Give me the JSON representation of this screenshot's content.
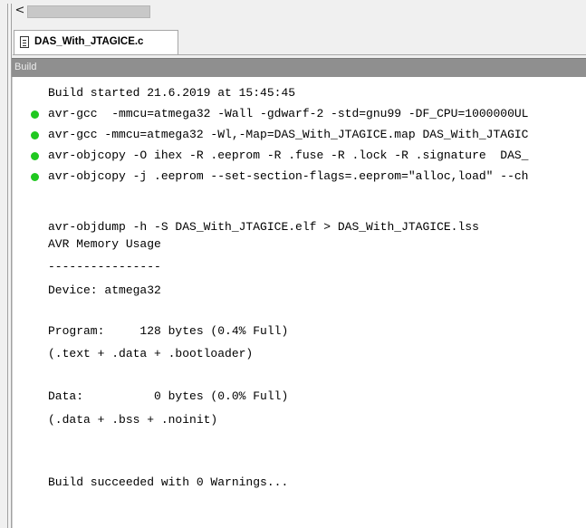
{
  "tab": {
    "file_label": "DAS_With_JTAGICE.c"
  },
  "panel": {
    "title": "Build"
  },
  "output": {
    "lines": [
      "Build started 21.6.2019 at 15:45:45",
      "avr-gcc  -mmcu=atmega32 -Wall -gdwarf-2 -std=gnu99 -DF_CPU=1000000UL",
      "avr-gcc -mmcu=atmega32 -Wl,-Map=DAS_With_JTAGICE.map DAS_With_JTAGIC",
      "avr-objcopy -O ihex -R .eeprom -R .fuse -R .lock -R .signature  DAS_",
      "avr-objcopy -j .eeprom --set-section-flags=.eeprom=\"alloc,load\" --ch",
      "avr-objdump -h -S DAS_With_JTAGICE.elf > DAS_With_JTAGICE.lss",
      "AVR Memory Usage",
      "----------------",
      "Device: atmega32",
      "Program:     128 bytes (0.4% Full)",
      "(.text + .data + .bootloader)",
      "Data:          0 bytes (0.0% Full)",
      "(.data + .bss + .noinit)",
      "Build succeeded with 0 Warnings..."
    ]
  },
  "colors": {
    "success_dot": "#20c820",
    "panel_header": "#8f8f8f"
  },
  "icons": {
    "scroll_left": "chevron-left-icon",
    "file": "file-icon",
    "status": "green-dot-icon"
  }
}
